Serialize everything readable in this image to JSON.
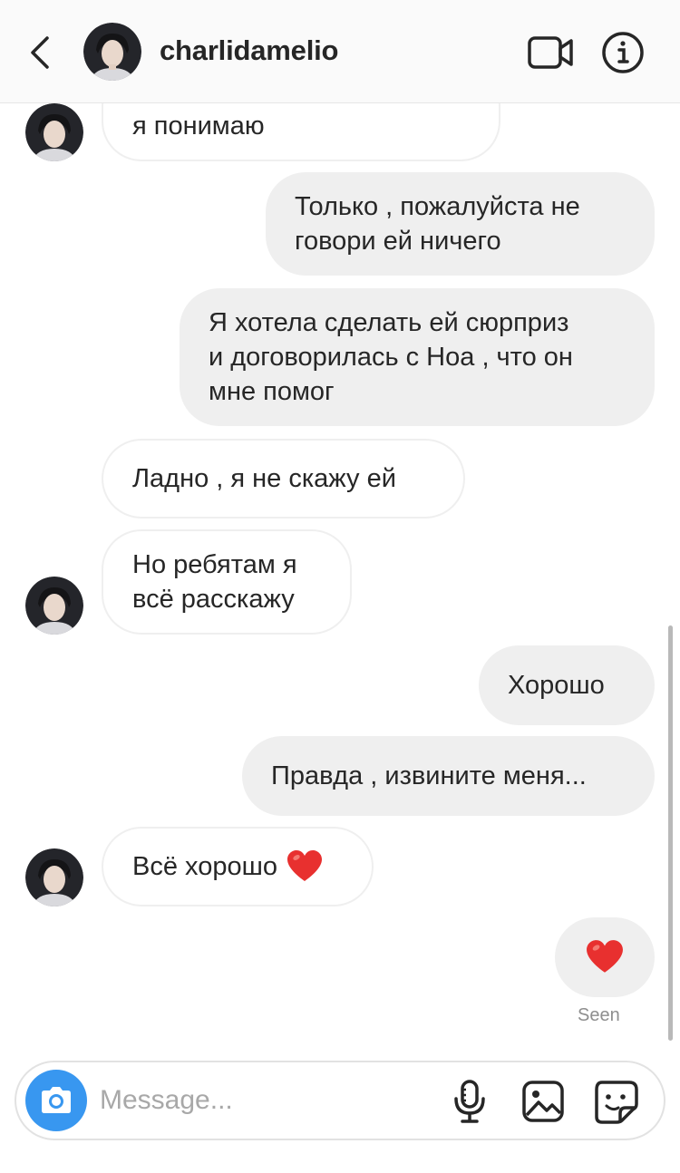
{
  "header": {
    "username": "charlidamelio",
    "icons": {
      "back": "chevron-left-icon",
      "video": "video-camera-icon",
      "info": "info-icon"
    }
  },
  "messages": [
    {
      "side": "in",
      "text": "я понимаю",
      "partial": true
    },
    {
      "side": "out",
      "text": "Только , пожалуйста не\nговори ей ничего"
    },
    {
      "side": "out",
      "text": "Я хотела сделать ей сюрприз\nи договорилась с Ноа , что он\nмне помог"
    },
    {
      "side": "in",
      "text": "Ладно , я не скажу ей"
    },
    {
      "side": "in",
      "text": "Но ребятам я\nвсё расскажу"
    },
    {
      "side": "out",
      "text": "Хорошо"
    },
    {
      "side": "out",
      "text": "Правда , извините меня..."
    },
    {
      "side": "in",
      "text": "Всё хорошо"
    },
    {
      "side": "out",
      "text": "",
      "reaction": "red-heart"
    }
  ],
  "status": {
    "seen": "Seen"
  },
  "composer": {
    "placeholder": "Message...",
    "icons": {
      "camera": "camera-icon",
      "mic": "microphone-icon",
      "gallery": "image-icon",
      "sticker": "sticker-icon"
    }
  },
  "colors": {
    "accent": "#3897f0",
    "bubble_out": "#efefef",
    "heart": "#e8302f",
    "text": "#262626",
    "muted": "#8e8e8e"
  }
}
